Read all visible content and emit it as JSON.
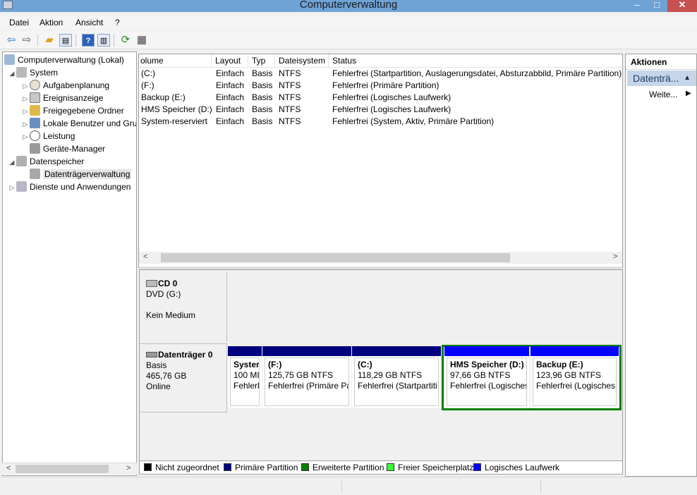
{
  "window": {
    "title": "Computerverwaltung",
    "minimize": "–",
    "maximize": "□",
    "close": "✕"
  },
  "menu": [
    "Datei",
    "Aktion",
    "Ansicht",
    "?"
  ],
  "toolbar": {
    "icons": [
      "back-icon",
      "forward-icon",
      "up-folder-icon",
      "show-hide-tree-icon",
      "help-icon",
      "show-action-pane-icon",
      "refresh-icon",
      "properties-icon"
    ]
  },
  "tree": {
    "root": "Computerverwaltung (Lokal)",
    "system": "System",
    "system_items": [
      "Aufgabenplanung",
      "Ereignisanzeige",
      "Freigegebene Ordner",
      "Lokale Benutzer und Gruppen",
      "Leistung",
      "Geräte-Manager"
    ],
    "storage": "Datenspeicher",
    "storage_items": [
      "Datenträgerverwaltung"
    ],
    "services": "Dienste und Anwendungen"
  },
  "volume_list": {
    "headers": [
      "olume",
      "Layout",
      "Typ",
      "Dateisystem",
      "Status"
    ],
    "rows": [
      [
        "(C:)",
        "Einfach",
        "Basis",
        "NTFS",
        "Fehlerfrei (Startpartition, Auslagerungsdatei, Absturzabbild, Primäre Partition)"
      ],
      [
        "(F:)",
        "Einfach",
        "Basis",
        "NTFS",
        "Fehlerfrei (Primäre Partition)"
      ],
      [
        "Backup (E:)",
        "Einfach",
        "Basis",
        "NTFS",
        "Fehlerfrei (Logisches Laufwerk)"
      ],
      [
        "HMS Speicher (D:)",
        "Einfach",
        "Basis",
        "NTFS",
        "Fehlerfrei (Logisches Laufwerk)"
      ],
      [
        "System-reserviert",
        "Einfach",
        "Basis",
        "NTFS",
        "Fehlerfrei (System, Aktiv, Primäre Partition)"
      ]
    ]
  },
  "disks": {
    "cd0": {
      "name": "CD 0",
      "type": "DVD (G:)",
      "state": "Kein Medium"
    },
    "disk0": {
      "name": "Datenträger 0",
      "type": "Basis",
      "size": "465,76 GB",
      "status": "Online",
      "partitions": [
        {
          "name": "Syster",
          "size": "100 MI",
          "status": "Fehlerl",
          "kind": "primary"
        },
        {
          "name": "(F:)",
          "size": "125,75 GB NTFS",
          "status": "Fehlerfrei (Primäre Pa",
          "kind": "primary"
        },
        {
          "name": "(C:)",
          "size": "118,29 GB NTFS",
          "status": "Fehlerfrei (Startpartiti",
          "kind": "primary"
        },
        {
          "name": "HMS Speicher  (D:)",
          "size": "97,66 GB NTFS",
          "status": "Fehlerfrei (Logisches",
          "kind": "logical"
        },
        {
          "name": "Backup  (E:)",
          "size": "123,96 GB NTFS",
          "status": "Fehlerfrei (Logisches",
          "kind": "logical"
        }
      ]
    }
  },
  "legend": [
    {
      "label": "Nicht zugeordnet",
      "color": "#000000"
    },
    {
      "label": "Primäre Partition",
      "color": "#000080"
    },
    {
      "label": "Erweiterte Partition",
      "color": "#008000"
    },
    {
      "label": "Freier Speicherplatz",
      "color": "#33ff33"
    },
    {
      "label": "Logisches Laufwerk",
      "color": "#0000ff"
    }
  ],
  "actions": {
    "header": "Aktionen",
    "section": "Datenträ...",
    "more": "Weite..."
  },
  "colors": {
    "primary": "#000080",
    "logical": "#0000ff",
    "extended": "#008000",
    "selection": "#c6d6ea"
  }
}
